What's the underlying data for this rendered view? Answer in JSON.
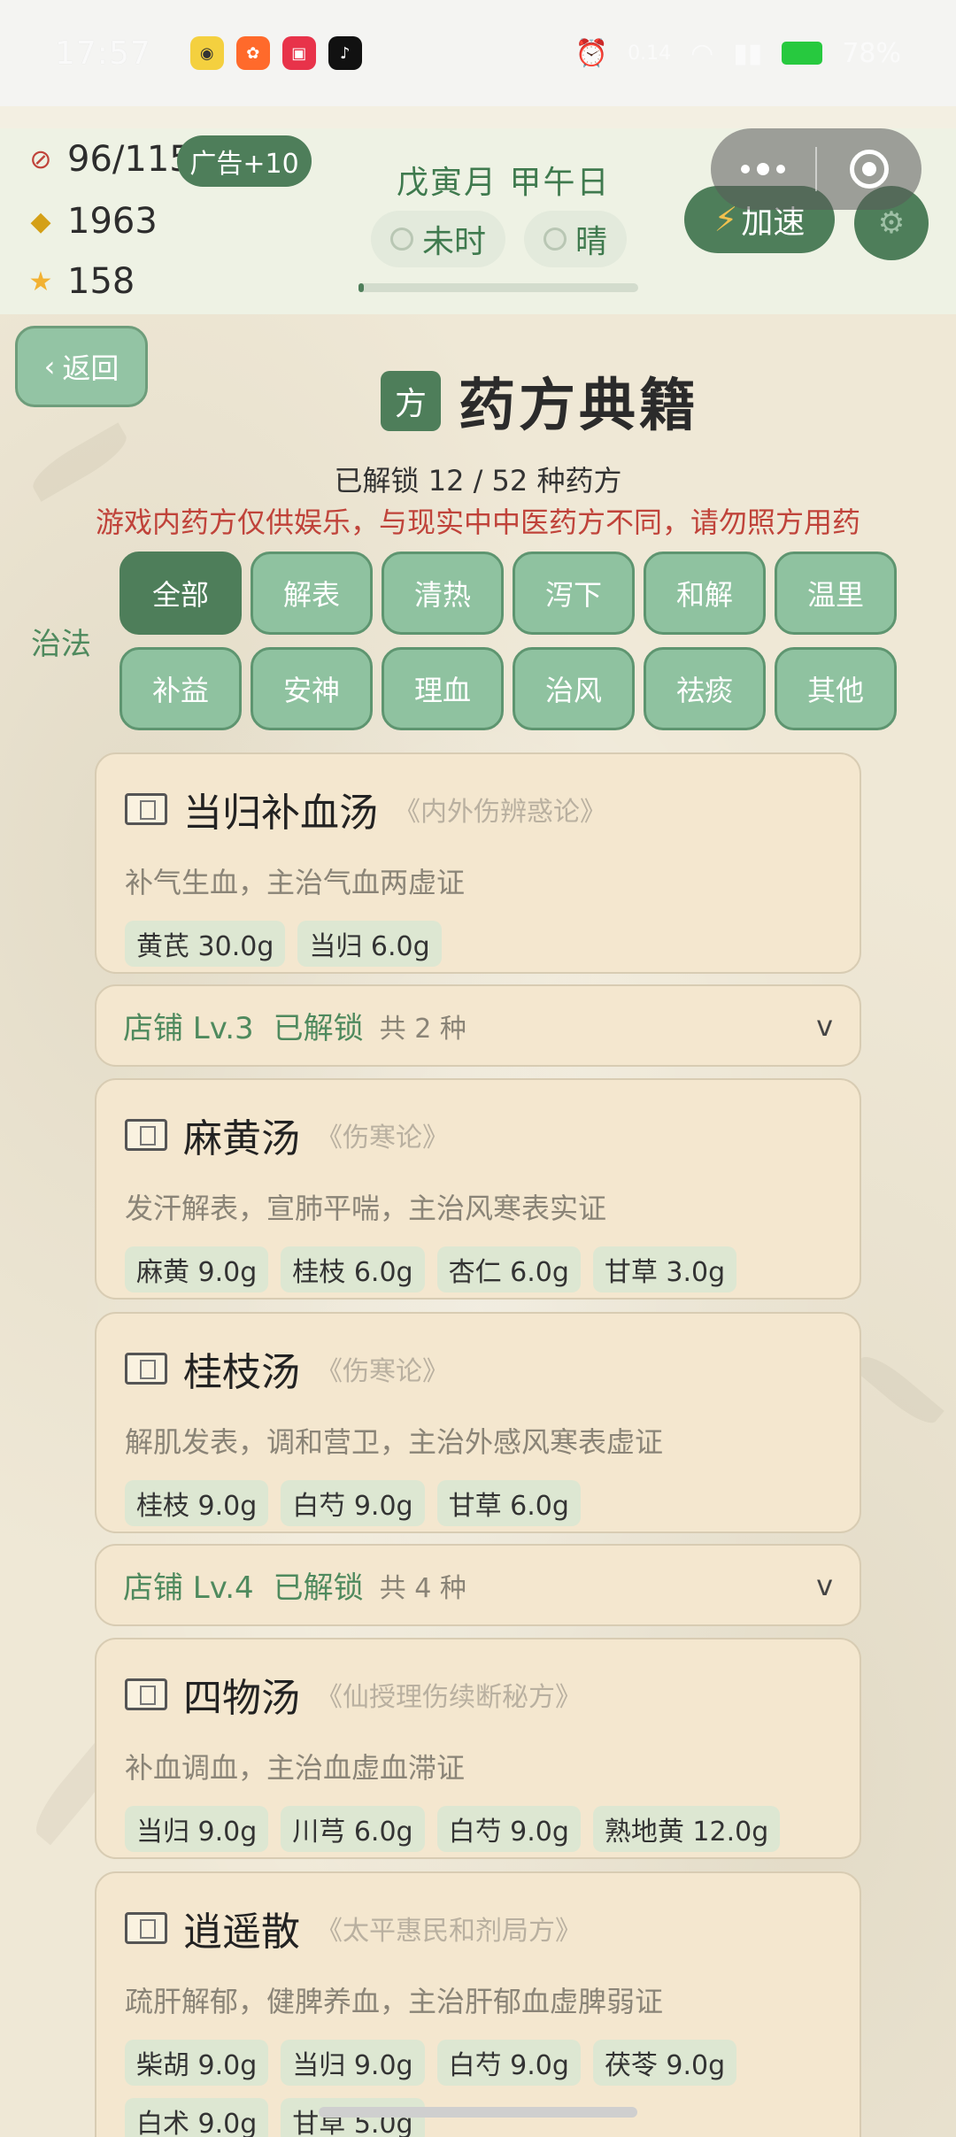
{
  "status_bar": {
    "time": "17:57",
    "net_speed": "0.14",
    "battery": "78%"
  },
  "hud": {
    "energy": "96/115",
    "ad_button": "广告+10",
    "coins": "1963",
    "stars": "158",
    "date": "戊寅月 甲午日",
    "time_of_day": "未时",
    "weather": "晴",
    "day_progress": 0.02,
    "speed_button": "加速"
  },
  "header": {
    "back_label": "返回",
    "badge": "方",
    "title": "药方典籍",
    "unlock_text": "已解锁 12 / 52 种药方",
    "warning": "游戏内药方仅供娱乐，与现实中中医药方不同，请勿照方用药"
  },
  "filters": {
    "label": "治法",
    "options": [
      "全部",
      "解表",
      "清热",
      "泻下",
      "和解",
      "温里",
      "补益",
      "安神",
      "理血",
      "治风",
      "祛痰",
      "其他"
    ],
    "active": "全部"
  },
  "recipes": [
    {
      "name": "当归补血汤",
      "source": "《内外伤辨惑论》",
      "desc": "补气生血，主治气血两虚证",
      "herbs": [
        "黄芪 30.0g",
        "当归 6.0g"
      ]
    },
    {
      "name": "麻黄汤",
      "source": "《伤寒论》",
      "desc": "发汗解表，宣肺平喘，主治风寒表实证",
      "herbs": [
        "麻黄 9.0g",
        "桂枝 6.0g",
        "杏仁 6.0g",
        "甘草 3.0g"
      ]
    },
    {
      "name": "桂枝汤",
      "source": "《伤寒论》",
      "desc": "解肌发表，调和营卫，主治外感风寒表虚证",
      "herbs": [
        "桂枝 9.0g",
        "白芍 9.0g",
        "甘草 6.0g"
      ]
    },
    {
      "name": "四物汤",
      "source": "《仙授理伤续断秘方》",
      "desc": "补血调血，主治血虚血滞证",
      "herbs": [
        "当归 9.0g",
        "川芎 6.0g",
        "白芍 9.0g",
        "熟地黄 12.0g"
      ]
    },
    {
      "name": "逍遥散",
      "source": "《太平惠民和剂局方》",
      "desc": "疏肝解郁，健脾养血，主治肝郁血虚脾弱证",
      "herbs": [
        "柴胡 9.0g",
        "当归 9.0g",
        "白芍 9.0g",
        "茯苓 9.0g",
        "白术 9.0g",
        "甘草 5.0g"
      ]
    }
  ],
  "sections": [
    {
      "level": "店铺 Lv.3",
      "status": "已解锁",
      "count": "共 2 种",
      "chevron": "v"
    },
    {
      "level": "店铺 Lv.4",
      "status": "已解锁",
      "count": "共 4 种",
      "chevron": "v"
    }
  ]
}
